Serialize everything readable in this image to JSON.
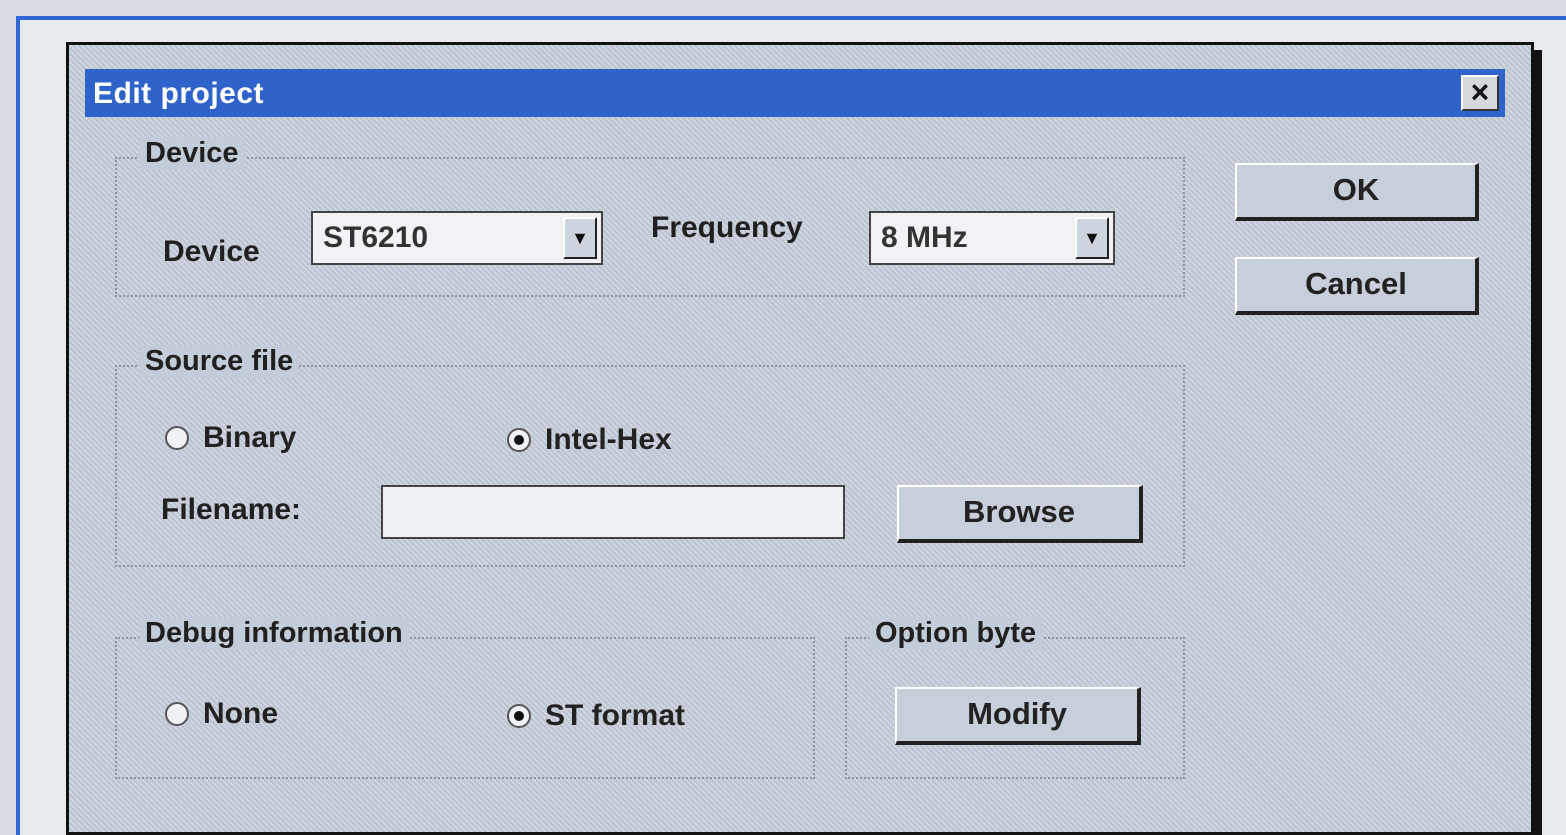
{
  "dialog": {
    "title": "Edit project",
    "close_symbol": "×"
  },
  "device_group": {
    "title": "Device",
    "device_label": "Device",
    "device_value": "ST6210",
    "frequency_label": "Frequency",
    "frequency_value": "8 MHz",
    "dropdown_symbol": "▼"
  },
  "source_group": {
    "title": "Source file",
    "binary_label": "Binary",
    "binary_selected": false,
    "intel_hex_label": "Intel-Hex",
    "intel_hex_selected": true,
    "filename_label": "Filename:",
    "filename_value": "",
    "browse_label": "Browse"
  },
  "debug_group": {
    "title": "Debug information",
    "none_label": "None",
    "none_selected": false,
    "st_format_label": "ST format",
    "st_format_selected": true
  },
  "option_group": {
    "title": "Option byte",
    "modify_label": "Modify"
  },
  "actions": {
    "ok_label": "OK",
    "cancel_label": "Cancel"
  },
  "icons": {
    "close": "close-icon",
    "dropdown": "chevron-down-icon"
  },
  "colors": {
    "titlebar": "#2f63c9",
    "dialog": "#c3ccd9",
    "frame": "#2f67d6"
  }
}
